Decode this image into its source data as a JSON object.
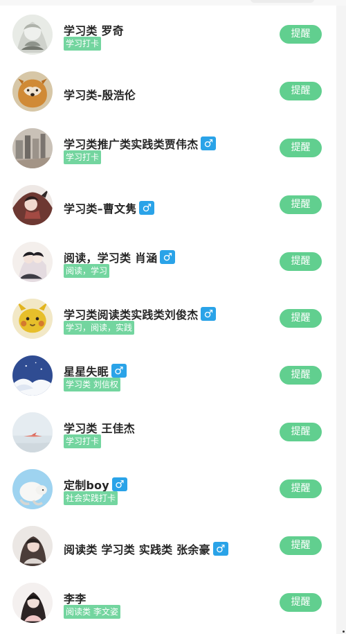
{
  "colors": {
    "accent": "#61cf8f",
    "tag_bg": "#73d59f",
    "gender_badge": "#2aa3e8"
  },
  "list": {
    "items": [
      {
        "name": "学习类 罗奇",
        "tag": "学习打卡",
        "gender_icon": "",
        "avatar_icon": "anime-avatar",
        "button_label": "提醒"
      },
      {
        "name": "学习类-殷浩伦",
        "tag": "",
        "gender_icon": "",
        "avatar_icon": "dog-avatar",
        "button_label": "提醒"
      },
      {
        "name": "学习类推广类实践类贾伟杰",
        "tag": "学习打卡",
        "gender_icon": "♂",
        "avatar_icon": "city-avatar",
        "button_label": "提醒"
      },
      {
        "name": "学习类–曹文隽",
        "tag": "",
        "gender_icon": "♂",
        "avatar_icon": "anime-avatar",
        "button_label": "提醒"
      },
      {
        "name": "阅读，学习类 肖涵",
        "tag": "阅读，学习",
        "gender_icon": "♂",
        "avatar_icon": "anime-avatar",
        "button_label": "提醒"
      },
      {
        "name": "学习类阅读类实践类刘俊杰",
        "tag": "学习，阅读，实践",
        "gender_icon": "♂",
        "avatar_icon": "pikachu-avatar",
        "button_label": "提醒"
      },
      {
        "name": "星星失眠",
        "tag": "学习类 刘信权",
        "gender_icon": "♂",
        "avatar_icon": "night-sky-avatar",
        "button_label": "提醒"
      },
      {
        "name": "学习类 王佳杰",
        "tag": "学习打卡",
        "gender_icon": "",
        "avatar_icon": "sky-avatar",
        "button_label": "提醒"
      },
      {
        "name": "定制boy",
        "tag": "社会实践打卡",
        "gender_icon": "♂",
        "avatar_icon": "sheep-avatar",
        "button_label": "提醒"
      },
      {
        "name": "阅读类 学习类 实践类 张余豪",
        "tag": "",
        "gender_icon": "♂",
        "avatar_icon": "girl-avatar",
        "button_label": "提醒"
      },
      {
        "name": "李李",
        "tag": "阅读类 李文姿",
        "gender_icon": "",
        "avatar_icon": "girl-avatar",
        "button_label": "提醒"
      }
    ]
  }
}
